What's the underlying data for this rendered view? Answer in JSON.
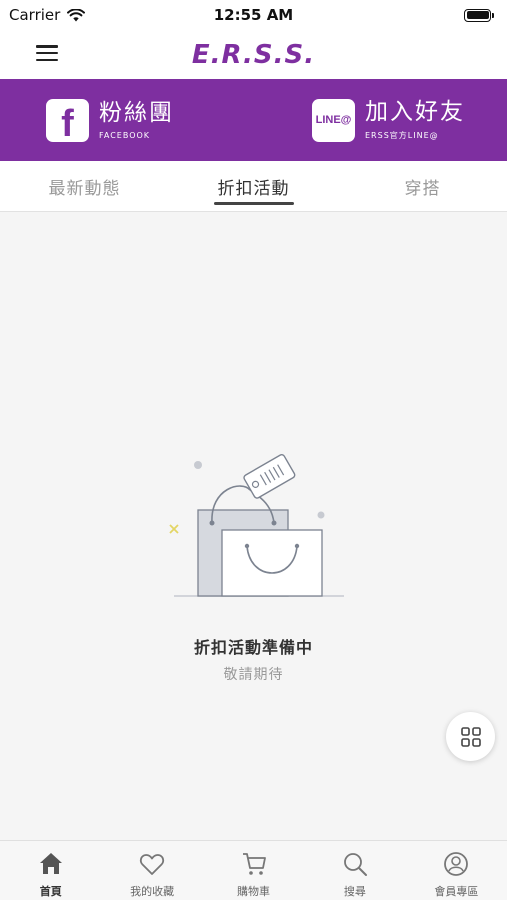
{
  "status_bar": {
    "carrier": "Carrier",
    "time": "12:55 AM"
  },
  "header": {
    "logo": "E.R.S.S."
  },
  "social": {
    "facebook": {
      "icon_text": "f",
      "title": "粉絲團",
      "subtitle": "FACEBOOK"
    },
    "line": {
      "icon_text": "LINE@",
      "title": "加入好友",
      "subtitle": "ERSS官方LINE@"
    }
  },
  "tabs": [
    {
      "label": "最新動態"
    },
    {
      "label": "折扣活動"
    },
    {
      "label": "穿搭"
    }
  ],
  "active_tab": "折扣活動",
  "empty_state": {
    "title": "折扣活動準備中",
    "subtitle": "敬請期待"
  },
  "bottom_nav": [
    {
      "label": "首頁",
      "icon": "home-icon"
    },
    {
      "label": "我的收藏",
      "icon": "heart-icon"
    },
    {
      "label": "購物車",
      "icon": "cart-icon"
    },
    {
      "label": "搜尋",
      "icon": "search-icon"
    },
    {
      "label": "會員專區",
      "icon": "user-icon"
    }
  ],
  "colors": {
    "brand": "#7e2fa0",
    "background": "#f5f5f5"
  }
}
